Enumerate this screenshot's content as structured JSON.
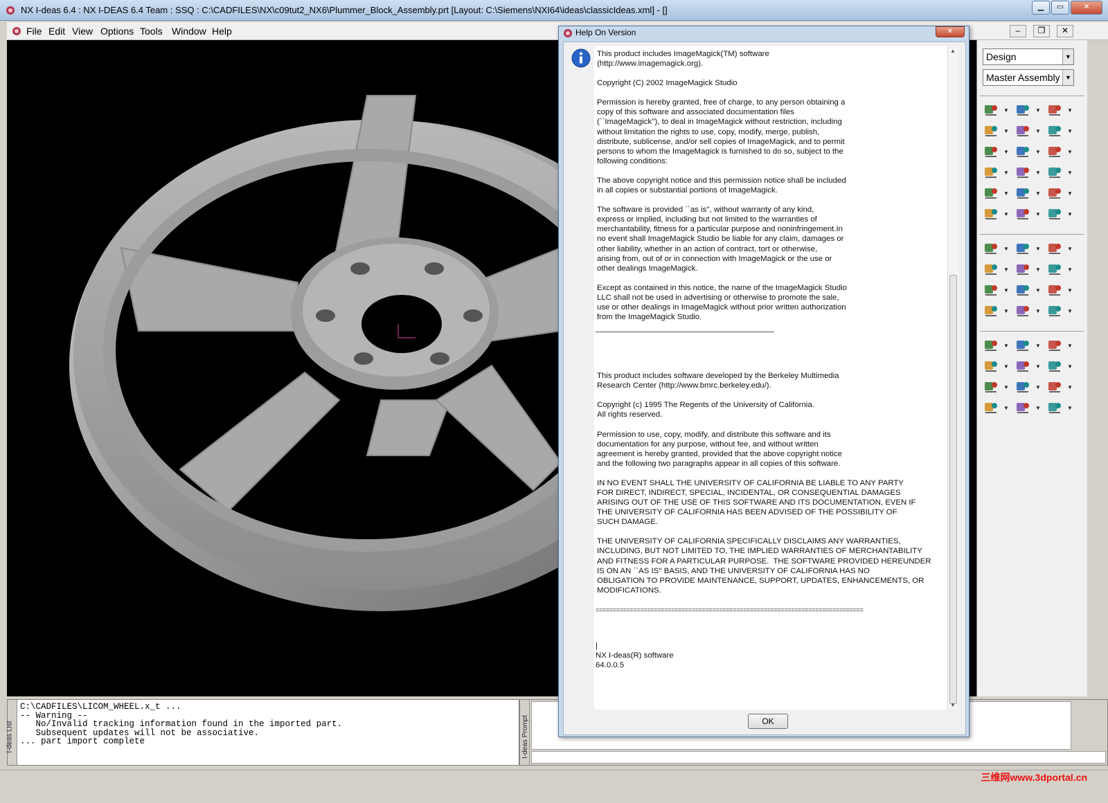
{
  "window": {
    "title": "NX I-deas 6.4 :    NX I-DEAS 6.4 Team : SSQ : C:\\CADFILES\\NX\\c09tut2_NX6\\Plummer_Block_Assembly.prt    [Layout: C:\\Siemens\\NXI64\\ideas\\classicIdeas.xml]    - []",
    "minimize": "▁",
    "maximize": "▭",
    "close": "✕"
  },
  "menubar": {
    "items": [
      "File",
      "Edit",
      "View",
      "Options",
      "Tools",
      "Window",
      "Help"
    ]
  },
  "rightpanel": {
    "task_dropdown": "Design",
    "assembly_dropdown": "Master Assembly",
    "icons": [
      "hierarchy-icon",
      "hierarchy-add-icon",
      "hierarchy-edit-icon",
      "instance-icon",
      "component-icon",
      "relocate-icon",
      "bom-icon",
      "assembly-image-icon",
      "cube-part-icon",
      "dimension-icon",
      "constraint-icon",
      "part-gear-icon",
      "probe-icon",
      "network-icon",
      "sticky-note-icon",
      "configuration-icon",
      "scale-icon",
      "counter-icon",
      "node-icon",
      "snap-icon",
      "select-shape-icon",
      "window-select-icon",
      "info-icon",
      "paint-brush-icon",
      "arrows-icon",
      "ruler-icon",
      "container-icon",
      "eraser-icon",
      "copy-icon",
      "person-stand-icon",
      "shade-view-icon",
      "wireframe-view-icon",
      "hidden-line-icon",
      "zoom-window-icon",
      "zoom-icon",
      "eye-icon",
      "view-xz-icon",
      "rotate-view-icon",
      "stop-icon",
      "view-yx-icon",
      "view-yz-icon",
      "print-icon"
    ]
  },
  "dialog": {
    "title": "Help On Version",
    "close_label": "✕",
    "ok_label": "OK",
    "paragraphs": [
      "This product includes ImageMagick(TM) software\n(http://www.imagemagick.org).",
      "",
      "Copyright (C) 2002 ImageMagick Studio",
      "Permission is hereby granted, free of charge, to any person obtaining a\ncopy of this software and associated documentation files\n(``ImageMagick''), to deal in ImageMagick without restriction, including\nwithout limitation the rights to use, copy, modify, merge, publish,\ndistribute, sublicense, and/or sell copies of ImageMagick, and to permit\npersons to whom the ImageMagick is furnished to do so, subject to the\nfollowing conditions:",
      "The above copyright notice and this permission notice shall be included\nin all copies or substantial portions of ImageMagick.",
      "The software is provided ``as is'', without warranty of any kind,\nexpress or implied, including but not limited to the warranties of\nmerchantability, fitness for a particular purpose and noninfringement.In\nno event shall ImageMagick Studio be liable for any claim, damages or\nother liability, whether in an action of contract, tort or otherwise,\narising from, out of or in connection with ImageMagick or the use or\nother dealings ImageMagick.",
      "Except as contained in this notice, the name of the ImageMagick Studio\nLLC shall not be used in advertising or otherwise to promote the sale,\nuse or other dealings in ImageMagick without prior written authorization\nfrom the ImageMagick Studio."
    ],
    "paragraphs2": [
      "This product includes software developed by the Berkeley Multimedia\nResearch Center (http://www.bmrc.berkeley.edu/).",
      "",
      "Copyright (c) 1995 The Regents of the University of California.\nAll rights reserved.",
      "Permission to use, copy, modify, and distribute this software and its\ndocumentation for any purpose, without fee, and without written\nagreement is hereby granted, provided that the above copyright notice\nand the following two paragraphs appear in all copies of this software.",
      "IN NO EVENT SHALL THE UNIVERSITY OF CALIFORNIA BE LIABLE TO ANY PARTY\nFOR DIRECT, INDIRECT, SPECIAL, INCIDENTAL, OR CONSEQUENTIAL DAMAGES\nARISING OUT OF THE USE OF THIS SOFTWARE AND ITS DOCUMENTATION, EVEN IF\nTHE UNIVERSITY OF CALIFORNIA HAS BEEN ADVISED OF THE POSSIBILITY OF\nSUCH DAMAGE.",
      "THE UNIVERSITY OF CALIFORNIA SPECIFICALLY DISCLAIMS ANY WARRANTIES,\nINCLUDING, BUT NOT LIMITED TO, THE IMPLIED WARRANTIES OF MERCHANTABILITY\nAND FITNESS FOR A PARTICULAR PURPOSE.  THE SOFTWARE PROVIDED HEREUNDER\nIS ON AN ``AS IS'' BASIS, AND THE UNIVERSITY OF CALIFORNIA HAS NO\nOBLIGATION TO PROVIDE MAINTENANCE, SUPPORT, UPDATES, ENHANCEMENTS, OR\nMODIFICATIONS."
    ],
    "separator": "==============================================================================",
    "footer": "|\nNX I-deas(R) software\n64.0.0.5"
  },
  "list_pane": {
    "label": "I-deas List",
    "text": "C:\\CADFILES\\LICOM_WHEEL.x_t ...\n-- Warning --\n   No/Invalid tracking information found in the imported part.\n   Subsequent updates will not be associative.\n... part import complete"
  },
  "prompt_pane": {
    "label": "I-deas Prompt"
  },
  "statusbar": {
    "watermark": "三维网www.3dportal.cn"
  },
  "colors": {
    "viewport_bg": "#000000",
    "part_grey": "#a8a8a8",
    "dialog_frame": "#c8d9ec"
  }
}
